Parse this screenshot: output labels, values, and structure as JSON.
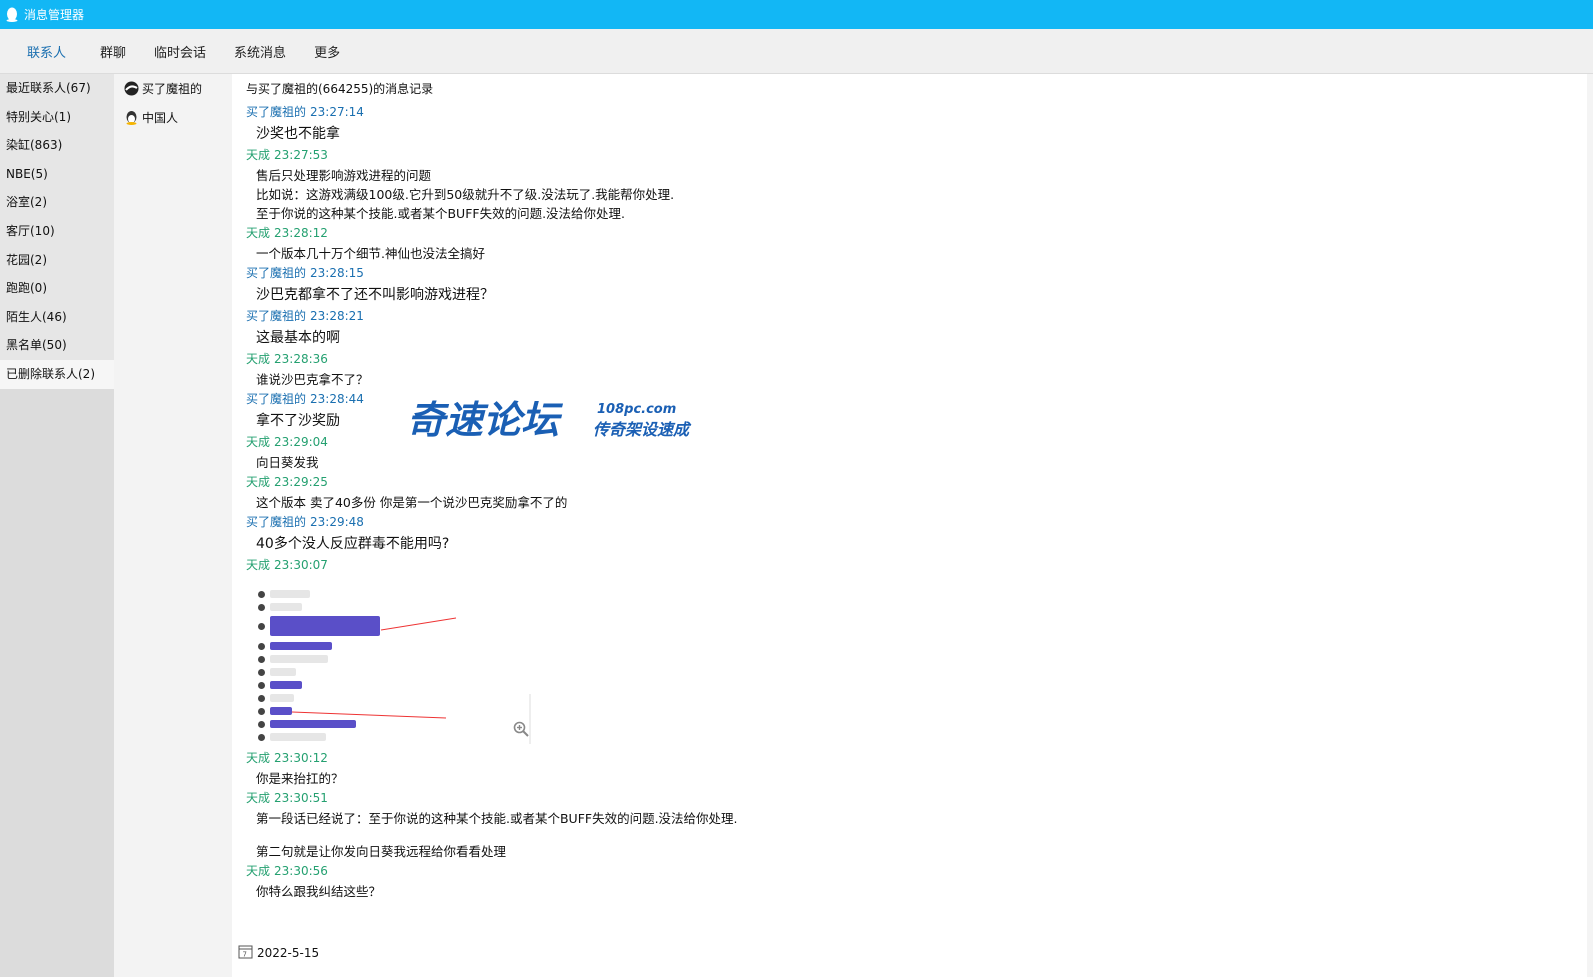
{
  "window": {
    "title": "消息管理器",
    "icon": "qq-penguin-icon",
    "accent": "#12b7f5"
  },
  "tabs": [
    {
      "label": "联系人",
      "active": true
    },
    {
      "label": "群聊",
      "active": false
    },
    {
      "label": "临时会话",
      "active": false
    },
    {
      "label": "系统消息",
      "active": false
    },
    {
      "label": "更多",
      "active": false
    }
  ],
  "groups": [
    {
      "label": "最近联系人(67)"
    },
    {
      "label": "特别关心(1)"
    },
    {
      "label": "染缸(863)"
    },
    {
      "label": "NBE(5)"
    },
    {
      "label": "浴室(2)"
    },
    {
      "label": "客厅(10)"
    },
    {
      "label": "花园(2)"
    },
    {
      "label": "跑跑(0)"
    },
    {
      "label": "陌生人(46)"
    },
    {
      "label": "黑名单(50)"
    },
    {
      "label": "已删除联系人(2)",
      "selected": true
    }
  ],
  "contacts": [
    {
      "name": "买了魔祖的"
    },
    {
      "name": "中国人"
    }
  ],
  "chat": {
    "header": "与买了魔祖的(664255)的消息记录",
    "messages": [
      {
        "sender": "买了魔祖的",
        "time": "23:27:14",
        "role": "buyer",
        "lines": [
          "沙奖也不能拿"
        ],
        "big": true
      },
      {
        "sender": "天成",
        "time": "23:27:53",
        "role": "me",
        "lines": [
          "售后只处理影响游戏进程的问题",
          "比如说：这游戏满级100级.它升到50级就升不了级.没法玩了.我能帮你处理.",
          "至于你说的这种某个技能.或者某个BUFF失效的问题.没法给你处理."
        ],
        "big": false
      },
      {
        "sender": "天成",
        "time": "23:28:12",
        "role": "me",
        "lines": [
          "一个版本几十万个细节.神仙也没法全搞好"
        ],
        "big": false
      },
      {
        "sender": "买了魔祖的",
        "time": "23:28:15",
        "role": "buyer",
        "lines": [
          "沙巴克都拿不了还不叫影响游戏进程？"
        ],
        "big": true
      },
      {
        "sender": "买了魔祖的",
        "time": "23:28:21",
        "role": "buyer",
        "lines": [
          "这最基本的啊"
        ],
        "big": true
      },
      {
        "sender": "天成",
        "time": "23:28:36",
        "role": "me",
        "lines": [
          "谁说沙巴克拿不了？"
        ],
        "big": false
      },
      {
        "sender": "买了魔祖的",
        "time": "23:28:44",
        "role": "buyer",
        "lines": [
          "拿不了沙奖励"
        ],
        "big": true
      },
      {
        "sender": "天成",
        "time": "23:29:04",
        "role": "me",
        "lines": [
          "向日葵发我"
        ],
        "big": false
      },
      {
        "sender": "天成",
        "time": "23:29:25",
        "role": "me",
        "lines": [
          "这个版本 卖了40多份  你是第一个说沙巴克奖励拿不了的"
        ],
        "big": false
      },
      {
        "sender": "买了魔祖的",
        "time": "23:29:48",
        "role": "buyer",
        "lines": [
          "40多个没人反应群毒不能用吗?"
        ],
        "big": true
      },
      {
        "sender": "天成",
        "time": "23:30:07",
        "role": "me",
        "lines": [],
        "image": true,
        "big": false
      },
      {
        "sender": "天成",
        "time": "23:30:12",
        "role": "me",
        "lines": [
          "你是来抬扛的？"
        ],
        "big": false
      },
      {
        "sender": "天成",
        "time": "23:30:51",
        "role": "me",
        "lines": [
          "第一段话已经说了：至于你说的这种某个技能.或者某个BUFF失效的问题.没法给你处理.",
          "",
          "第二句就是让你发向日葵我远程给你看看处理"
        ],
        "big": false
      },
      {
        "sender": "天成",
        "time": "23:30:56",
        "role": "me",
        "lines": [
          "你特么跟我纠结这些？"
        ],
        "big": false
      }
    ]
  },
  "date": {
    "value": "2022-5-15",
    "icon": "calendar-icon"
  },
  "watermark": {
    "brand": "奇速论坛",
    "domain": "108pc.com",
    "slogan": "传奇架设速成",
    "color": "#1a5fb4"
  }
}
